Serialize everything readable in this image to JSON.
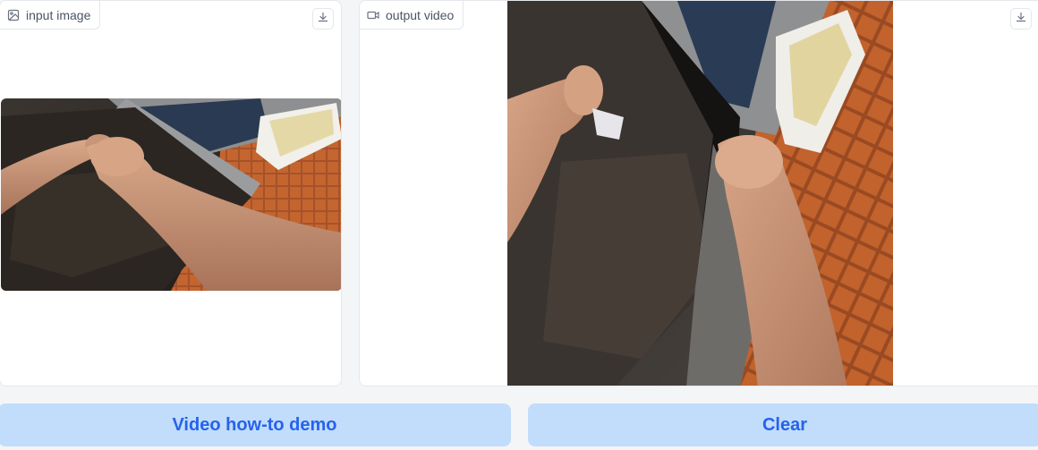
{
  "input_panel": {
    "label": "input image",
    "icon": "image-icon",
    "download_icon": "download-icon"
  },
  "output_panel": {
    "label": "output video",
    "icon": "video-icon",
    "download_icon": "download-icon"
  },
  "buttons": {
    "demo_label": "Video how-to demo",
    "clear_label": "Clear"
  },
  "colors": {
    "button_bg": "#c2dcfb",
    "button_text": "#2563eb",
    "panel_border": "#e5e7eb",
    "page_bg": "#f4f5f7"
  }
}
